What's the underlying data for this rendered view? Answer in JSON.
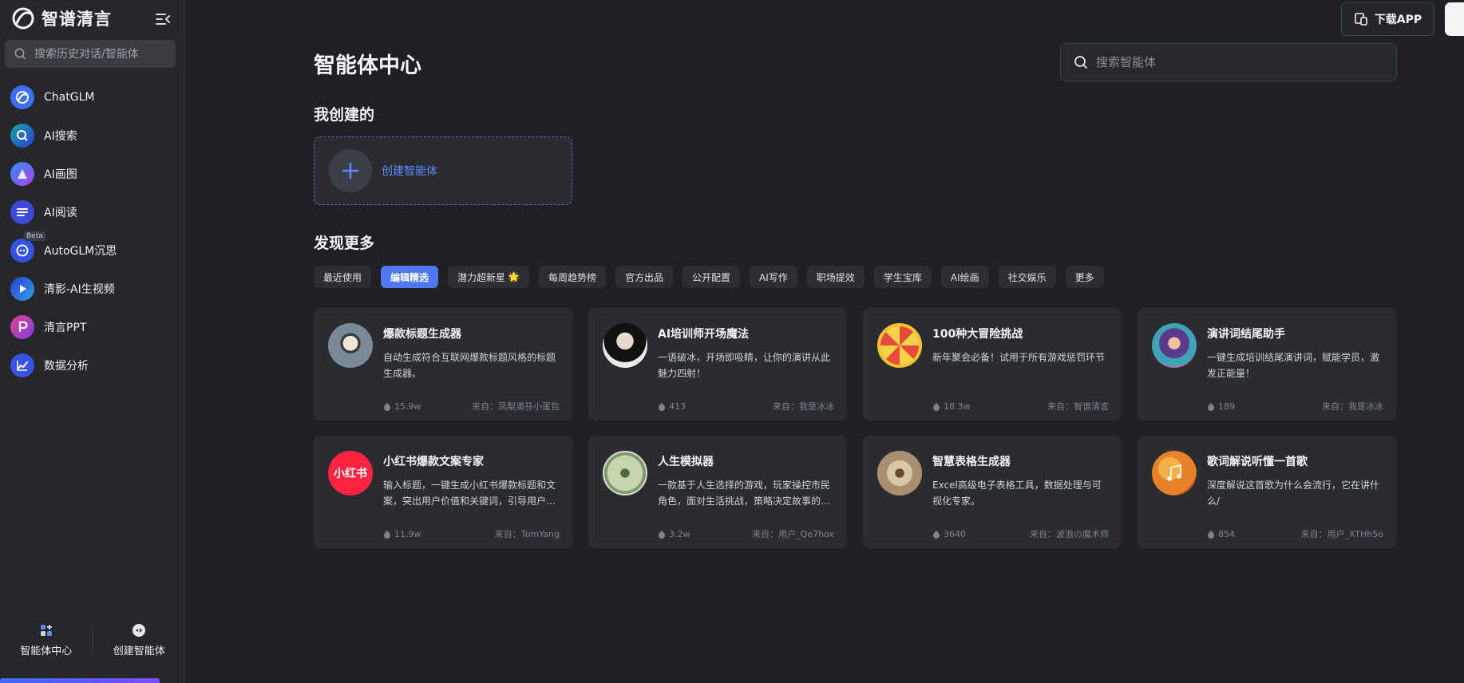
{
  "brand": {
    "name": "智谱清言"
  },
  "sidebar": {
    "search_placeholder": "搜索历史对话/智能体",
    "items": [
      {
        "label": "ChatGLM",
        "icon": "chatglm-icon",
        "color": "#3d6ff5"
      },
      {
        "label": "AI搜索",
        "icon": "ai-search-icon",
        "color": "#1aa6a0"
      },
      {
        "label": "AI画图",
        "icon": "ai-draw-icon",
        "color": "#7a4cf2"
      },
      {
        "label": "AI阅读",
        "icon": "ai-read-icon",
        "color": "#3f49d8"
      },
      {
        "label": "AutoGLM沉思",
        "icon": "autoglm-icon",
        "color": "#3353e6",
        "badge": "Beta"
      },
      {
        "label": "清影-AI生视频",
        "icon": "video-icon",
        "color": "#2a3fd4"
      },
      {
        "label": "清言PPT",
        "icon": "ppt-icon",
        "color": "#c73bd8"
      },
      {
        "label": "数据分析",
        "icon": "data-analysis-icon",
        "color": "#3a52e0"
      }
    ],
    "bottom": {
      "agent_center": "智能体中心",
      "create_agent": "创建智能体"
    }
  },
  "header": {
    "download_label": "下载APP"
  },
  "main": {
    "title": "智能体中心",
    "search_placeholder": "搜索智能体",
    "my_created_title": "我创建的",
    "create_label": "创建智能体",
    "discover_title": "发现更多",
    "tabs": [
      {
        "label": "最近使用"
      },
      {
        "label": "编辑精选",
        "active": true
      },
      {
        "label": "潜力超新星",
        "emoji": "🌟"
      },
      {
        "label": "每周趋势榜"
      },
      {
        "label": "官方出品"
      },
      {
        "label": "公开配置"
      },
      {
        "label": "AI写作"
      },
      {
        "label": "职场提效"
      },
      {
        "label": "学生宝库"
      },
      {
        "label": "AI绘画"
      },
      {
        "label": "社交娱乐"
      },
      {
        "label": "更多"
      }
    ],
    "cards": [
      {
        "title": "爆款标题生成器",
        "desc": "自动生成符合互联网爆款标题风格的标题生成器。",
        "count": "15.9w",
        "source": "来自：凤梨滴芬小蛋包",
        "avatar_color": "#8a8f96"
      },
      {
        "title": "AI培训师开场魔法",
        "desc": "一语破冰，开场即吸睛，让你的演讲从此魅力四射！",
        "count": "413",
        "source": "来自：我是冰冰",
        "avatar_color": "#d9dadc"
      },
      {
        "title": "100种大冒险挑战",
        "desc": "新年聚会必备！试用于所有游戏惩罚环节",
        "count": "18.3w",
        "source": "来自：智谱清言",
        "avatar_color": "#f1c232"
      },
      {
        "title": "演讲词结尾助手",
        "desc": "一键生成培训结尾演讲词，赋能学员，激发正能量！",
        "count": "189",
        "source": "来自：我是冰冰",
        "avatar_color": "#8e5aa8"
      },
      {
        "title": "小红书爆款文案专家",
        "desc": "输入标题，一键生成小红书爆款标题和文案，突出用户价值和关键词，引导用户互动。",
        "count": "11.9w",
        "source": "来自：TomYang",
        "avatar_color": "#ff2442",
        "avatar_text": "小红书"
      },
      {
        "title": "人生模拟器",
        "desc": "一款基于人生选择的游戏，玩家操控市民角色，面对生活挑战，策略决定故事的发展。",
        "count": "3.2w",
        "source": "来自：用户_Qe7hox",
        "avatar_color": "#b9c6a4"
      },
      {
        "title": "智慧表格生成器",
        "desc": "Excel高级电子表格工具，数据处理与可视化专家。",
        "count": "3640",
        "source": "来自：波浪の魔术师",
        "avatar_color": "#a88f6e"
      },
      {
        "title": "歌词解说听懂一首歌",
        "desc": "深度解说这首歌为什么会流行，它在讲什么/",
        "count": "854",
        "source": "来自：用户_XTHh5o",
        "avatar_color": "#e8822a"
      }
    ]
  }
}
